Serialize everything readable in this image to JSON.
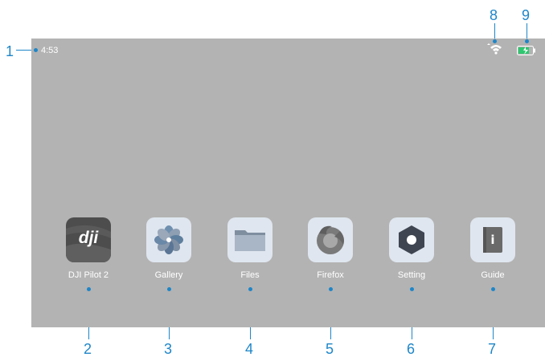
{
  "status_bar": {
    "time": "4:53"
  },
  "apps": [
    {
      "label": "DJI Pilot 2",
      "logo_text": "dji"
    },
    {
      "label": "Gallery"
    },
    {
      "label": "Files"
    },
    {
      "label": "Firefox"
    },
    {
      "label": "Setting"
    },
    {
      "label": "Guide",
      "glyph": "i"
    }
  ],
  "callouts": [
    "1",
    "2",
    "3",
    "4",
    "5",
    "6",
    "7",
    "8",
    "9"
  ],
  "colors": {
    "callout": "#1e86c8",
    "screen": "#b3b3b3",
    "battery": "#2ec870"
  }
}
